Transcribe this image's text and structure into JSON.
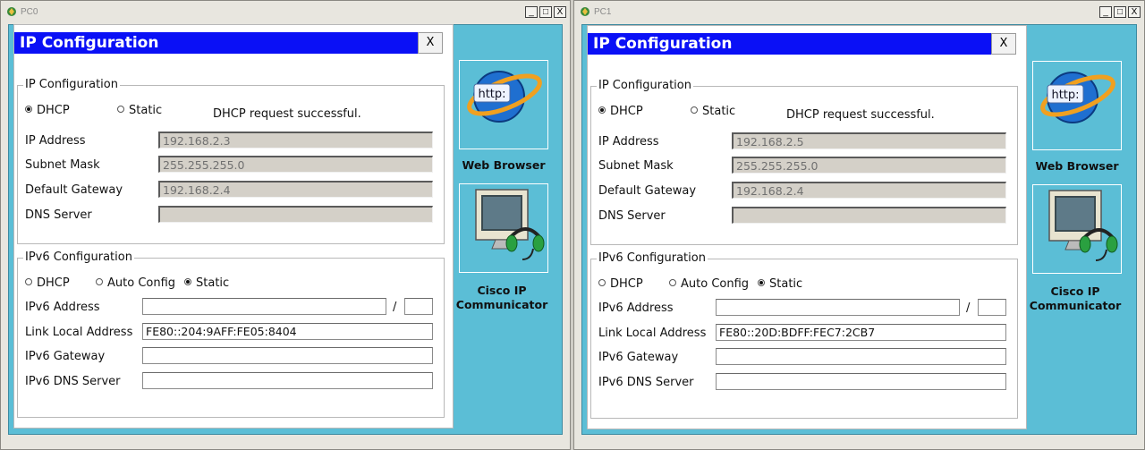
{
  "windows": [
    {
      "title": "PC0",
      "controls": [
        "_",
        "□",
        "X"
      ],
      "dialog": {
        "title": "IP Configuration",
        "close": "X",
        "ipv4": {
          "legend": "IP Configuration",
          "dhcp_label": "DHCP",
          "static_label": "Static",
          "mode": "DHCP",
          "status": "DHCP request successful.",
          "ip_label": "IP Address",
          "ip": "192.168.2.3",
          "mask_label": "Subnet Mask",
          "mask": "255.255.255.0",
          "gw_label": "Default Gateway",
          "gw": "192.168.2.4",
          "dns_label": "DNS Server",
          "dns": ""
        },
        "ipv6": {
          "legend": "IPv6 Configuration",
          "dhcp_label": "DHCP",
          "auto_label": "Auto Config",
          "static_label": "Static",
          "mode": "Static",
          "addr_label": "IPv6 Address",
          "addr": "",
          "slash": "/",
          "prefix": "",
          "lla_label": "Link Local Address",
          "lla": "FE80::204:9AFF:FE05:8404",
          "gw_label": "IPv6 Gateway",
          "gw": "",
          "dns_label": "IPv6 DNS Server",
          "dns": ""
        }
      },
      "apps": [
        {
          "label": "Web Browser",
          "icon": "web-browser-icon",
          "icon_text": "http:"
        },
        {
          "label": "Cisco IP Communicator",
          "icon": "cisco-ip-communicator-icon"
        }
      ]
    },
    {
      "title": "PC1",
      "controls": [
        "_",
        "□",
        "X"
      ],
      "dialog": {
        "title": "IP Configuration",
        "close": "X",
        "ipv4": {
          "legend": "IP Configuration",
          "dhcp_label": "DHCP",
          "static_label": "Static",
          "mode": "DHCP",
          "status": "DHCP request successful.",
          "ip_label": "IP Address",
          "ip": "192.168.2.5",
          "mask_label": "Subnet Mask",
          "mask": "255.255.255.0",
          "gw_label": "Default Gateway",
          "gw": "192.168.2.4",
          "dns_label": "DNS Server",
          "dns": ""
        },
        "ipv6": {
          "legend": "IPv6 Configuration",
          "dhcp_label": "DHCP",
          "auto_label": "Auto Config",
          "static_label": "Static",
          "mode": "Static",
          "addr_label": "IPv6 Address",
          "addr": "",
          "slash": "/",
          "prefix": "",
          "lla_label": "Link Local Address",
          "lla": "FE80::20D:BDFF:FEC7:2CB7",
          "gw_label": "IPv6 Gateway",
          "gw": "",
          "dns_label": "IPv6 DNS Server",
          "dns": ""
        }
      },
      "apps": [
        {
          "label": "Web Browser",
          "icon": "web-browser-icon",
          "icon_text": "http:"
        },
        {
          "label": "Cisco IP Communicator",
          "icon": "cisco-ip-communicator-icon"
        }
      ]
    }
  ],
  "colors": {
    "dialog_title_bg": "#0a10f6",
    "desktop_bg": "#5bbed6",
    "chrome_bg": "#d4d0c8"
  }
}
